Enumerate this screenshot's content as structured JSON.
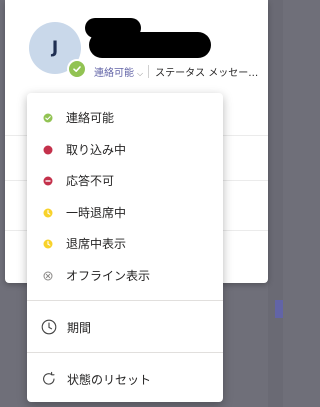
{
  "profile": {
    "avatar_initial": "J",
    "status_label": "連絡可能",
    "status_message": "ステータス メッセー…"
  },
  "menu": {
    "presence_items": [
      {
        "label": "連絡可能",
        "icon": "available-dot-icon",
        "color": "#92c353"
      },
      {
        "label": "取り込み中",
        "icon": "busy-dot-icon",
        "color": "#c4314b"
      },
      {
        "label": "応答不可",
        "icon": "do-not-disturb-icon",
        "color": "#c4314b"
      },
      {
        "label": "一時退席中",
        "icon": "be-right-back-icon",
        "color": "#f8d22a"
      },
      {
        "label": "退席中表示",
        "icon": "away-icon",
        "color": "#f8d22a"
      },
      {
        "label": "オフライン表示",
        "icon": "offline-icon",
        "color": "#8a8886"
      }
    ],
    "duration_label": "期間",
    "reset_label": "状態のリセット"
  }
}
